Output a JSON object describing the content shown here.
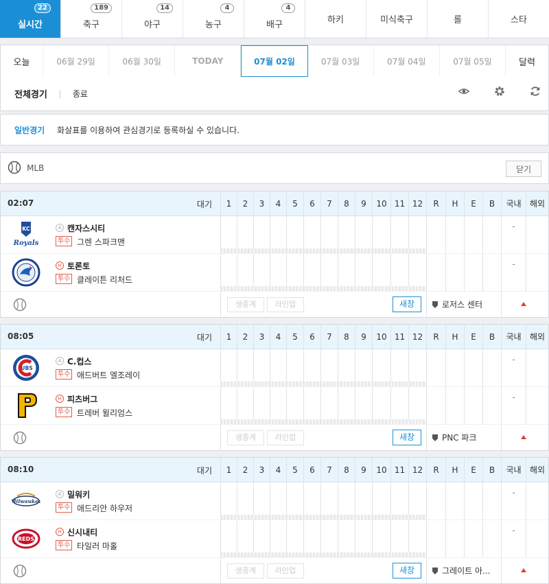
{
  "tabs": [
    {
      "label": "실시간",
      "badge": "22",
      "active": true
    },
    {
      "label": "축구",
      "badge": "189"
    },
    {
      "label": "야구",
      "badge": "14"
    },
    {
      "label": "농구",
      "badge": "4"
    },
    {
      "label": "배구",
      "badge": "4"
    },
    {
      "label": "하키",
      "badge": ""
    },
    {
      "label": "미식축구",
      "badge": ""
    },
    {
      "label": "롤",
      "badge": ""
    },
    {
      "label": "스타",
      "badge": ""
    }
  ],
  "dates": {
    "today": "오늘",
    "items": [
      "06월 29일",
      "06월 30일",
      "TODAY",
      "07월 02일",
      "07월 03일",
      "07월 04일",
      "07월 05일"
    ],
    "calendar": "달력"
  },
  "filter": {
    "all": "전체경기",
    "ended": "종료"
  },
  "info": {
    "title": "일반경기",
    "text": "화살표를 이용하여 관심경기로 등록하실 수 있습니다."
  },
  "league": {
    "name": "MLB",
    "close": "닫기"
  },
  "columns": [
    "1",
    "2",
    "3",
    "4",
    "5",
    "6",
    "7",
    "8",
    "9",
    "10",
    "11",
    "12",
    "R",
    "H",
    "E",
    "B",
    "국내",
    "해외"
  ],
  "footer_labels": {
    "broadcast": "생중계",
    "lineup": "라인업",
    "refresh": "새창"
  },
  "pitcher_tag": "투수",
  "games": [
    {
      "time": "02:07",
      "status": "대기",
      "stadium": "로저스 센터",
      "away": {
        "team": "캔자스시티",
        "pitcher": "그렌 스파크맨",
        "ha": "A",
        "domestic": "-"
      },
      "home": {
        "team": "토론토",
        "pitcher": "클레이튼 리처드",
        "ha": "H",
        "domestic": "-"
      }
    },
    {
      "time": "08:05",
      "status": "대기",
      "stadium": "PNC 파크",
      "away": {
        "team": "C.컵스",
        "pitcher": "애드버트 엘조레이",
        "ha": "A",
        "domestic": "-"
      },
      "home": {
        "team": "피츠버그",
        "pitcher": "트레버 윌리엄스",
        "ha": "H",
        "domestic": "-"
      }
    },
    {
      "time": "08:10",
      "status": "대기",
      "stadium": "그레이트 아...",
      "away": {
        "team": "밀워키",
        "pitcher": "애드리안 하우저",
        "ha": "A",
        "domestic": "-"
      },
      "home": {
        "team": "신시내티",
        "pitcher": "타일러 마홀",
        "ha": "H",
        "domestic": "-"
      }
    }
  ],
  "colors": {
    "accent": "#1b8fd6",
    "header_bg": "#e9f5fc",
    "pitcher": "#e05a4a",
    "arrow": "#e04030"
  }
}
